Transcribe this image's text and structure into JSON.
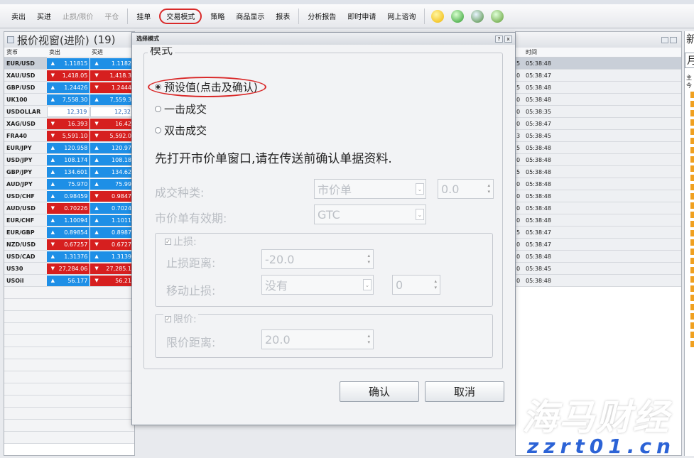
{
  "toolbar": {
    "items": [
      "卖出",
      "买进",
      "止损/限价",
      "平仓",
      "挂单",
      "交易模式",
      "策略",
      "商品显示",
      "报表",
      "分析报告",
      "即时申请",
      "网上谘询"
    ],
    "icons": [
      "lightbulb-icon",
      "refresh-icon",
      "chart-icon",
      "plugin-icon"
    ]
  },
  "quote_panel": {
    "title": "报价视窗(进阶)",
    "count": "(19)",
    "columns": [
      "货币",
      "卖出",
      "买进"
    ],
    "rows": [
      {
        "symbol": "EUR/USD",
        "sell": "1.11815",
        "buy": "1.1182",
        "sdir": "up",
        "bdir": "up"
      },
      {
        "symbol": "XAU/USD",
        "sell": "1,418.05",
        "buy": "1,418.3",
        "sdir": "dn",
        "bdir": "dn"
      },
      {
        "symbol": "GBP/USD",
        "sell": "1.24426",
        "buy": "1.2444",
        "sdir": "up",
        "bdir": "dn"
      },
      {
        "symbol": "UK100",
        "sell": "7,558.30",
        "buy": "7,559.3",
        "sdir": "up",
        "bdir": "up"
      },
      {
        "symbol": "USDOLLAR",
        "sell": "12,319",
        "buy": "12,32",
        "sdir": "flat",
        "bdir": "flat"
      },
      {
        "symbol": "XAG/USD",
        "sell": "16.393",
        "buy": "16.42",
        "sdir": "dn",
        "bdir": "dn"
      },
      {
        "symbol": "FRA40",
        "sell": "5,591.10",
        "buy": "5,592.0",
        "sdir": "dn",
        "bdir": "dn"
      },
      {
        "symbol": "EUR/JPY",
        "sell": "120.958",
        "buy": "120.97",
        "sdir": "up",
        "bdir": "up"
      },
      {
        "symbol": "USD/JPY",
        "sell": "108.174",
        "buy": "108.18",
        "sdir": "up",
        "bdir": "up"
      },
      {
        "symbol": "GBP/JPY",
        "sell": "134.601",
        "buy": "134.62",
        "sdir": "up",
        "bdir": "up"
      },
      {
        "symbol": "AUD/JPY",
        "sell": "75.970",
        "buy": "75.99",
        "sdir": "up",
        "bdir": "up"
      },
      {
        "symbol": "USD/CHF",
        "sell": "0.98459",
        "buy": "0.9847",
        "sdir": "up",
        "bdir": "dn"
      },
      {
        "symbol": "AUD/USD",
        "sell": "0.70226",
        "buy": "0.7024",
        "sdir": "dn",
        "bdir": "up"
      },
      {
        "symbol": "EUR/CHF",
        "sell": "1.10094",
        "buy": "1.1011",
        "sdir": "up",
        "bdir": "up"
      },
      {
        "symbol": "EUR/GBP",
        "sell": "0.89854",
        "buy": "0.8987",
        "sdir": "up",
        "bdir": "up"
      },
      {
        "symbol": "NZD/USD",
        "sell": "0.67257",
        "buy": "0.6727",
        "sdir": "dn",
        "bdir": "dn"
      },
      {
        "symbol": "USD/CAD",
        "sell": "1.31376",
        "buy": "1.3139",
        "sdir": "up",
        "bdir": "up"
      },
      {
        "symbol": "US30",
        "sell": "27,284.06",
        "buy": "27,285.1",
        "sdir": "dn",
        "bdir": "dn"
      },
      {
        "symbol": "USOil",
        "sell": "56.177",
        "buy": "56.21",
        "sdir": "up",
        "bdir": "dn"
      }
    ]
  },
  "time_panel": {
    "header": "时间",
    "rows": [
      {
        "d": "5",
        "t": "05:38:48"
      },
      {
        "d": "0",
        "t": "05:38:47"
      },
      {
        "d": "5",
        "t": "05:38:48"
      },
      {
        "d": "0",
        "t": "05:38:48"
      },
      {
        "d": "0",
        "t": "05:38:35"
      },
      {
        "d": "0",
        "t": "05:38:47"
      },
      {
        "d": "3",
        "t": "05:38:45"
      },
      {
        "d": "5",
        "t": "05:38:48"
      },
      {
        "d": "0",
        "t": "05:38:48"
      },
      {
        "d": "5",
        "t": "05:38:48"
      },
      {
        "d": "0",
        "t": "05:38:48"
      },
      {
        "d": "0",
        "t": "05:38:48"
      },
      {
        "d": "0",
        "t": "05:38:48"
      },
      {
        "d": "0",
        "t": "05:38:48"
      },
      {
        "d": "5",
        "t": "05:38:47"
      },
      {
        "d": "0",
        "t": "05:38:47"
      },
      {
        "d": "0",
        "t": "05:38:48"
      },
      {
        "d": "0",
        "t": "05:38:45"
      },
      {
        "d": "0",
        "t": "05:38:48"
      }
    ]
  },
  "right_panel": {
    "title": "新",
    "input": "月",
    "label1": "主",
    "label2": "今"
  },
  "dialog": {
    "title": "选择模式",
    "help": "?",
    "close": "x",
    "group_legend": "模式",
    "radio_default": "预设值(点击及确认)",
    "radio_single": "一击成交",
    "radio_double": "双击成交",
    "info": "先打开市价单窗口,请在传送前确认单据资料.",
    "order_type_label": "成交种类:",
    "order_type_value": "市价单",
    "order_type_num": "0.0",
    "validity_label": "市价单有效期:",
    "validity_value": "GTC",
    "stop_legend": "止损:",
    "stop_distance_label": "止损距离:",
    "stop_distance_value": "-20.0",
    "trailing_label": "移动止损:",
    "trailing_value": "没有",
    "trailing_num": "0",
    "limit_legend": "限价:",
    "limit_distance_label": "限价距离:",
    "limit_distance_value": "20.0",
    "ok": "确认",
    "cancel": "取消"
  },
  "watermark": {
    "line1": "海马财经",
    "line2": "zzrt01.cn"
  },
  "colors": {
    "up": "#1e8fe6",
    "down": "#d61f1f",
    "highlight": "#d92a2a"
  }
}
